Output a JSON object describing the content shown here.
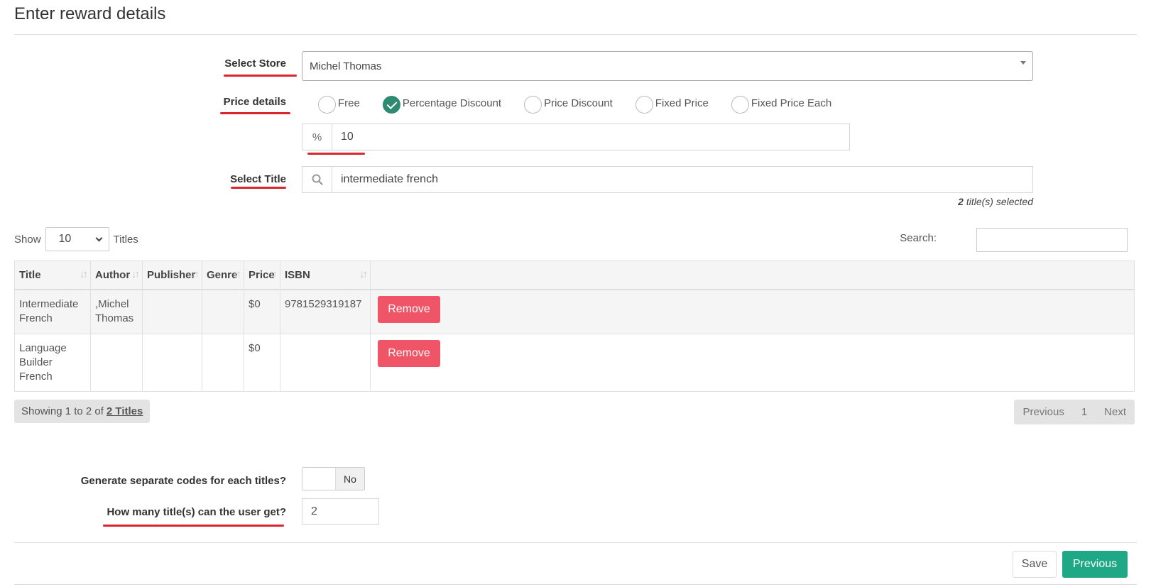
{
  "page": {
    "title": "Enter reward details"
  },
  "store": {
    "label": "Select Store",
    "value": "Michel Thomas"
  },
  "price": {
    "label": "Price details",
    "options": [
      {
        "label": "Free",
        "checked": false
      },
      {
        "label": "Percentage Discount",
        "checked": true
      },
      {
        "label": "Price Discount",
        "checked": false
      },
      {
        "label": "Fixed Price",
        "checked": false
      },
      {
        "label": "Fixed Price Each",
        "checked": false
      }
    ],
    "unit": "%",
    "value": "10"
  },
  "title_select": {
    "label": "Select Title",
    "search_value": "intermediate french",
    "selected_count": "2",
    "selected_suffix": "title(s) selected"
  },
  "table_controls": {
    "show_label": "Show",
    "page_length": "10",
    "titles_label": "Titles",
    "search_label": "Search:"
  },
  "table": {
    "columns": [
      "Title",
      "Author",
      "Publisher",
      "Genre",
      "Price",
      "ISBN"
    ],
    "rows": [
      {
        "title": "Intermediate French",
        "author": ",Michel Thomas",
        "publisher": "",
        "genre": "",
        "price": "$0",
        "isbn": "9781529319187",
        "action": "Remove"
      },
      {
        "title": "Language Builder French",
        "author": "",
        "publisher": "",
        "genre": "",
        "price": "$0",
        "isbn": "",
        "action": "Remove"
      }
    ]
  },
  "info": {
    "prefix": "Showing 1 to 2 of",
    "total": "2 Titles"
  },
  "pagination": {
    "previous": "Previous",
    "page": "1",
    "next": "Next"
  },
  "separate_codes": {
    "label": "Generate separate codes for each titles?",
    "state": "No"
  },
  "max_titles": {
    "label": "How many title(s) can the user get?",
    "value": "2"
  },
  "footer": {
    "save": "Save",
    "previous": "Previous"
  },
  "colors": {
    "accent": "#1ea885",
    "checked": "#2e8a72",
    "danger": "#ef5566",
    "annotation": "#d8262c"
  }
}
